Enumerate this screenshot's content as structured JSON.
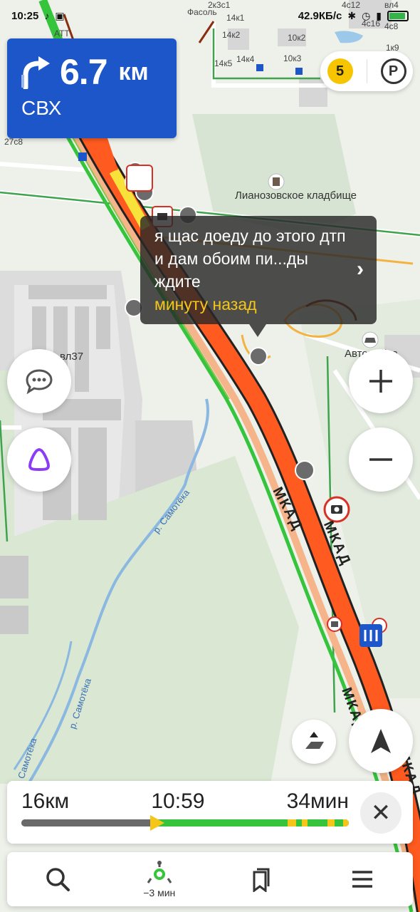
{
  "status_bar": {
    "time": "10:25",
    "net_speed": "42.9КБ/с"
  },
  "maneuver": {
    "distance_value": "6.7",
    "distance_unit": "км",
    "road": "СВХ"
  },
  "map": {
    "traffic_level": "5",
    "parking_label": "P",
    "labels": {
      "cemetery": "Лианозовское кладбище",
      "carwash": "Автомойка",
      "building_vl37": "вл37",
      "b_14k1": "14к1",
      "b_14k2": "14к2",
      "b_14k4": "14к4",
      "b_14k5": "14к5",
      "b_10k2": "10к2",
      "b_10k3": "10к3",
      "b_4c12": "4с12",
      "b_4c16": "4с16",
      "b_4c8": "4с8",
      "b_vl4": "вл4",
      "b_1k9": "1к9",
      "b_27c8": "27с8",
      "b_2k3c1": "2к3с1",
      "fasol": "Фасоль",
      "att": "АТТ"
    },
    "road_labels": {
      "mkad": "МКАД"
    },
    "river_labels": {
      "samoteka_full": "р. Самотёка",
      "samoteka_short": "Самотёка"
    }
  },
  "popup": {
    "message": "я щас доеду до этого дтп и дам обоим пи...ды ждите",
    "time_ago": "минуту назад"
  },
  "route_panel": {
    "distance": "16км",
    "arrival_time": "10:59",
    "duration": "34мин",
    "progress": 0.42
  },
  "bottom_nav": {
    "alt_route_label": "−3 мин"
  },
  "colors": {
    "maneuver_bg": "#1c56c9",
    "traffic_jam": "#ff5a1f",
    "free_flow": "#36c43c",
    "accent_yellow": "#f5c518"
  }
}
